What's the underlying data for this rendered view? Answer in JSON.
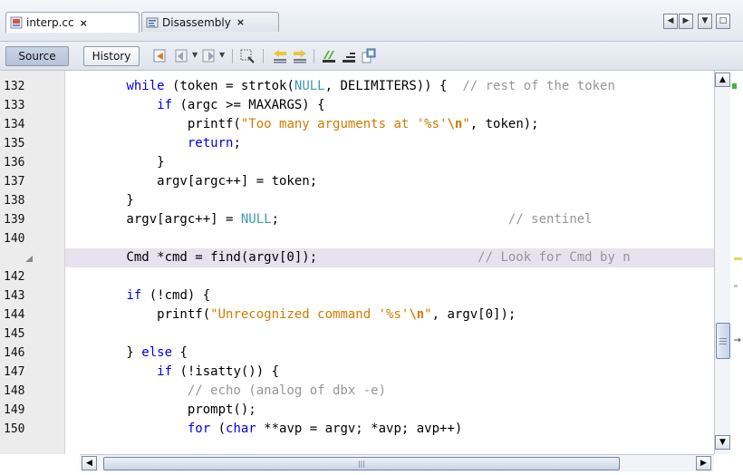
{
  "tabs": [
    {
      "label": "interp.cc",
      "active": true,
      "close_label": "×"
    },
    {
      "label": "Disassembly",
      "active": false,
      "close_label": "×"
    }
  ],
  "tab_nav": {
    "left": "◀",
    "right": "▶",
    "menu": "▼",
    "maximize": "□"
  },
  "toolbar": {
    "source_label": "Source",
    "history_label": "History"
  },
  "colors": {
    "keyword": "#0000e6",
    "string": "#ce7b00",
    "comment": "#969696",
    "macro": "#3a9bb0",
    "current_line": "#e7e2f0"
  },
  "editor": {
    "lines": [
      {
        "num": "132",
        "segs": [
          [
            "p",
            "        "
          ],
          [
            "kw",
            "while"
          ],
          [
            "p",
            " (token = strtok("
          ],
          [
            "mac",
            "NULL"
          ],
          [
            "p",
            ", DELIMITERS)) {  "
          ],
          [
            "cm",
            "// rest of the token"
          ]
        ]
      },
      {
        "num": "133",
        "segs": [
          [
            "p",
            "            "
          ],
          [
            "kw",
            "if"
          ],
          [
            "p",
            " (argc >= MAXARGS) {"
          ]
        ]
      },
      {
        "num": "134",
        "segs": [
          [
            "p",
            "                printf("
          ],
          [
            "str",
            "\"Too many arguments at '%s'"
          ],
          [
            "esc",
            "\\n"
          ],
          [
            "str",
            "\""
          ],
          [
            "p",
            ", token);"
          ]
        ]
      },
      {
        "num": "135",
        "segs": [
          [
            "p",
            "                "
          ],
          [
            "kw",
            "return"
          ],
          [
            "p",
            ";"
          ]
        ]
      },
      {
        "num": "136",
        "segs": [
          [
            "p",
            "            }"
          ]
        ]
      },
      {
        "num": "137",
        "segs": [
          [
            "p",
            "            argv[argc++] = token;"
          ]
        ]
      },
      {
        "num": "138",
        "segs": [
          [
            "p",
            "        }"
          ]
        ]
      },
      {
        "num": "139",
        "segs": [
          [
            "p",
            "        argv[argc++] = "
          ],
          [
            "mac",
            "NULL"
          ],
          [
            "p",
            ";                              "
          ],
          [
            "cm",
            "// sentinel"
          ]
        ]
      },
      {
        "num": "140",
        "segs": []
      },
      {
        "num": "",
        "current": true,
        "segs": [
          [
            "p",
            "        Cmd *cmd = find(argv[0]);                     "
          ],
          [
            "cm",
            "// Look for Cmd by n"
          ]
        ]
      },
      {
        "num": "142",
        "segs": []
      },
      {
        "num": "143",
        "segs": [
          [
            "p",
            "        "
          ],
          [
            "kw",
            "if"
          ],
          [
            "p",
            " (!cmd) {"
          ]
        ]
      },
      {
        "num": "144",
        "segs": [
          [
            "p",
            "            printf("
          ],
          [
            "str",
            "\"Unrecognized command '%s'"
          ],
          [
            "esc",
            "\\n"
          ],
          [
            "str",
            "\""
          ],
          [
            "p",
            ", argv[0]);"
          ]
        ]
      },
      {
        "num": "145",
        "segs": []
      },
      {
        "num": "146",
        "segs": [
          [
            "p",
            "        } "
          ],
          [
            "kw",
            "else"
          ],
          [
            "p",
            " {"
          ]
        ]
      },
      {
        "num": "147",
        "segs": [
          [
            "p",
            "            "
          ],
          [
            "kw",
            "if"
          ],
          [
            "p",
            " (!isatty()) {"
          ]
        ]
      },
      {
        "num": "148",
        "segs": [
          [
            "p",
            "                "
          ],
          [
            "cm",
            "// echo (analog of dbx -e)"
          ]
        ]
      },
      {
        "num": "149",
        "segs": [
          [
            "p",
            "                prompt();"
          ]
        ]
      },
      {
        "num": "150",
        "segs": [
          [
            "p",
            "                "
          ],
          [
            "kw",
            "for"
          ],
          [
            "p",
            " ("
          ],
          [
            "kw",
            "char"
          ],
          [
            "p",
            " **avp = argv; *avp; avp++)"
          ]
        ]
      }
    ]
  },
  "scrollbars": {
    "up": "▲",
    "down": "▼",
    "left": "◀",
    "right": "▶"
  }
}
